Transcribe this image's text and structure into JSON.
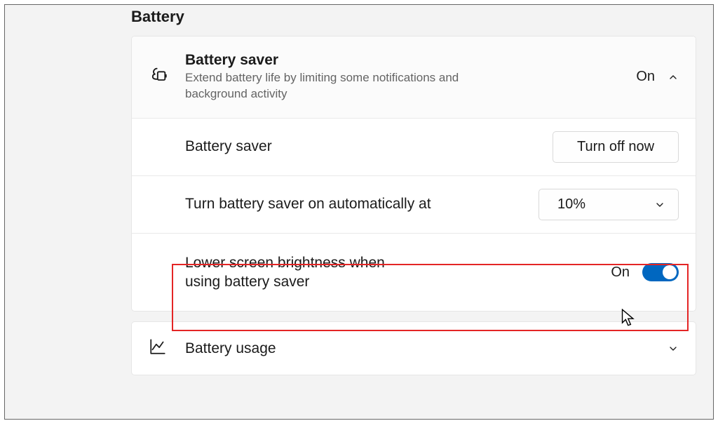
{
  "section_title": "Battery",
  "battery_saver": {
    "title": "Battery saver",
    "description": "Extend battery life by limiting some notifications and background activity",
    "status": "On",
    "sub": {
      "label": "Battery saver",
      "button": "Turn off now"
    },
    "auto": {
      "label": "Turn battery saver on automatically at",
      "value": "10%"
    },
    "brightness": {
      "label": "Lower screen brightness when using battery saver",
      "status": "On"
    }
  },
  "battery_usage": {
    "title": "Battery usage"
  }
}
